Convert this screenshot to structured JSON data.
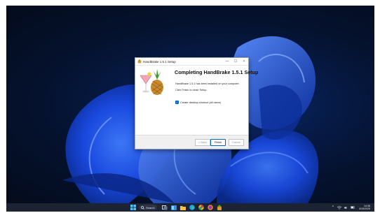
{
  "window": {
    "title": "HandBrake 1.5.1 Setup",
    "minimize": "—",
    "maximize": "☐",
    "close": "✕",
    "heading": "Completing HandBrake 1.5.1 Setup",
    "message": "HandBrake 1.5.1 has been installed on your computer.",
    "instruction": "Click Finish to close Setup.",
    "checkbox_label": "Create desktop shortcut (all users)",
    "checkbox_checked": true,
    "buttons": {
      "back": "< Back",
      "finish": "Finish",
      "cancel": "Cancel"
    }
  },
  "taskbar": {
    "search_label": "Search",
    "icons": [
      "start-icon",
      "search-icon",
      "task-view-icon",
      "widgets-icon",
      "file-explorer-icon",
      "edge-icon",
      "chrome-icon",
      "firefox-icon",
      "handbrake-icon"
    ],
    "tray": {
      "chevron": "^",
      "time": "14:36",
      "date": "4/15/2025"
    }
  },
  "colors": {
    "accent": "#0067c0",
    "taskbar": "#1c2333",
    "wallpaper_blue": "#1d5cff"
  }
}
